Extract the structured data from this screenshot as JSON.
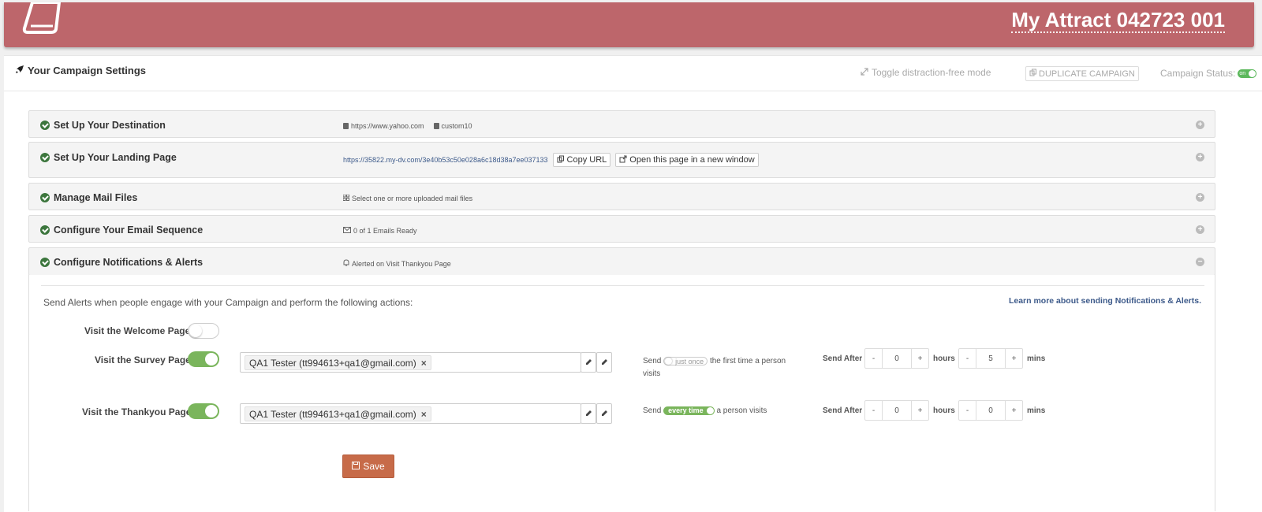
{
  "app": {
    "title": "My Attract 042723 001",
    "brand_color": "#bd666b"
  },
  "header": {
    "settings_title": "Your Campaign Settings",
    "distraction_free": "Toggle distraction-free mode",
    "duplicate": "DUPLICATE CAMPAIGN",
    "status_label": "Campaign Status:",
    "status_toggle": "on"
  },
  "sections": {
    "destination": {
      "title": "Set Up Your Destination",
      "url": "https://www.yahoo.com",
      "code": "custom10"
    },
    "landing": {
      "title": "Set Up Your Landing Page",
      "url": "https://35822.my-dv.com/3e40b53c50e028a6c18d38a7ee037133",
      "copy_label": "Copy URL",
      "open_label": "Open this page in a new window"
    },
    "mail": {
      "title": "Manage Mail Files",
      "info": "Select one or more uploaded mail files"
    },
    "email": {
      "title": "Configure Your Email Sequence",
      "info": "0 of 1 Emails Ready"
    },
    "notifications": {
      "title": "Configure Notifications & Alerts",
      "info": "Alerted on Visit Thankyou Page"
    }
  },
  "alerts": {
    "intro": "Send Alerts when people engage with your Campaign and perform the following actions:",
    "learn_more": "Learn more about sending Notifications & Alerts.",
    "rows": [
      {
        "label": "Visit the Welcome Page",
        "enabled": false
      },
      {
        "label": "Visit the Survey Page",
        "enabled": true,
        "recipient": "QA1 Tester (tt994613+qa1@gmail.com)",
        "send": "Send",
        "frequency": "just once",
        "frequency_tail": "the first time a person",
        "frequency_tail2": "visits",
        "send_after": "Send After",
        "hours": "0",
        "hours_unit": "hours",
        "mins": "5",
        "mins_unit": "mins"
      },
      {
        "label": "Visit the Thankyou Page",
        "enabled": true,
        "recipient": "QA1 Tester (tt994613+qa1@gmail.com)",
        "send": "Send",
        "frequency": "every time",
        "frequency_tail": "a person visits",
        "send_after": "Send After",
        "hours": "0",
        "hours_unit": "hours",
        "mins": "0",
        "mins_unit": "mins"
      }
    ],
    "save_label": "Save",
    "save_color": "#c76b49"
  },
  "stepper": {
    "minus": "-",
    "plus": "+"
  },
  "icons": {
    "remove_tag": "×",
    "collapse": "−",
    "expand": "+"
  }
}
